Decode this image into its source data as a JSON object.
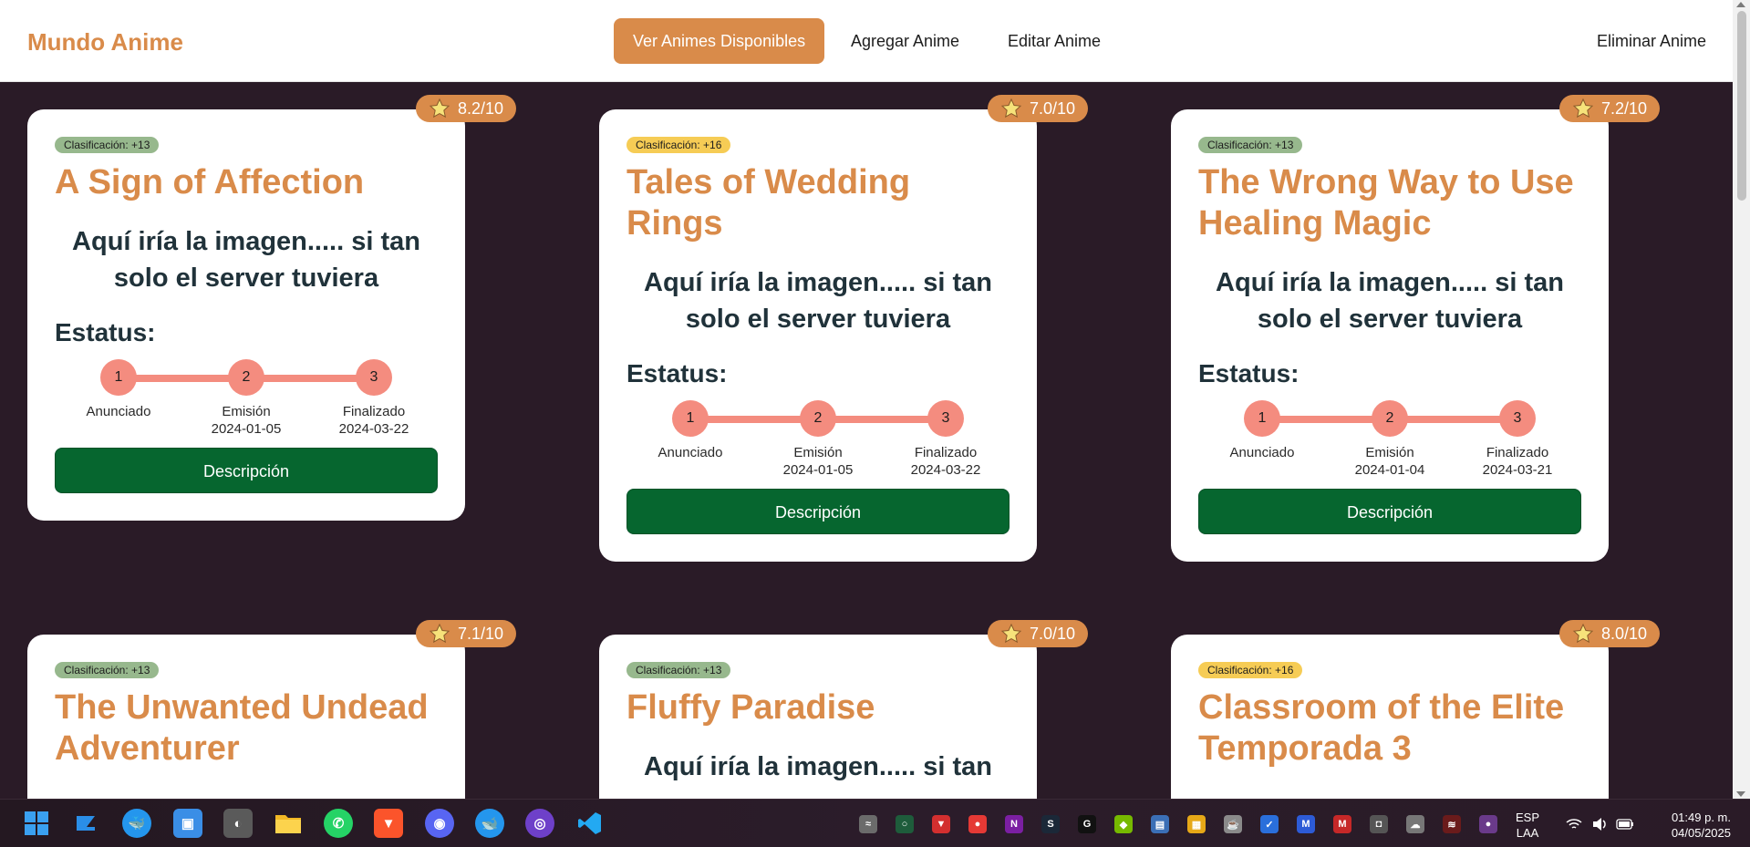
{
  "navbar": {
    "brand": "Mundo Anime",
    "links": [
      {
        "label": "Ver Animes Disponibles",
        "active": true
      },
      {
        "label": "Agregar Anime",
        "active": false
      },
      {
        "label": "Editar Anime",
        "active": false
      },
      {
        "label": "Eliminar Anime",
        "active": false
      }
    ]
  },
  "cards": [
    {
      "rating": "8.2/10",
      "classification": "Clasificación: +13",
      "classification_color": "green",
      "title": "A Sign of Affection",
      "image_placeholder": "Aquí iría la imagen..... si tan solo el server tuviera",
      "status_heading": "Estatus:",
      "steps": [
        {
          "number": "1",
          "label": "Anunciado",
          "date": ""
        },
        {
          "number": "2",
          "label": "Emisión",
          "date": "2024-01-05"
        },
        {
          "number": "3",
          "label": "Finalizado",
          "date": "2024-03-22"
        }
      ],
      "button": "Descripción"
    },
    {
      "rating": "7.0/10",
      "classification": "Clasificación: +16",
      "classification_color": "yellow",
      "title": "Tales of Wedding Rings",
      "image_placeholder": "Aquí iría la imagen..... si tan solo el server tuviera",
      "status_heading": "Estatus:",
      "steps": [
        {
          "number": "1",
          "label": "Anunciado",
          "date": ""
        },
        {
          "number": "2",
          "label": "Emisión",
          "date": "2024-01-05"
        },
        {
          "number": "3",
          "label": "Finalizado",
          "date": "2024-03-22"
        }
      ],
      "button": "Descripción"
    },
    {
      "rating": "7.2/10",
      "classification": "Clasificación: +13",
      "classification_color": "green",
      "title": "The Wrong Way to Use Healing Magic",
      "image_placeholder": "Aquí iría la imagen..... si tan solo el server tuviera",
      "status_heading": "Estatus:",
      "steps": [
        {
          "number": "1",
          "label": "Anunciado",
          "date": ""
        },
        {
          "number": "2",
          "label": "Emisión",
          "date": "2024-01-04"
        },
        {
          "number": "3",
          "label": "Finalizado",
          "date": "2024-03-21"
        }
      ],
      "button": "Descripción"
    },
    {
      "rating": "7.1/10",
      "classification": "Clasificación: +13",
      "classification_color": "green",
      "title": "The Unwanted Undead Adventurer"
    },
    {
      "rating": "7.0/10",
      "classification": "Clasificación: +13",
      "classification_color": "green",
      "title": "Fluffy Paradise",
      "image_placeholder": "Aquí iría la imagen..... si tan"
    },
    {
      "rating": "8.0/10",
      "classification": "Clasificación: +16",
      "classification_color": "yellow",
      "title": "Classroom of the Elite Temporada 3"
    }
  ],
  "taskbar": {
    "apps": [
      "windows-start",
      "dev-tool",
      "docker-desktop",
      "photo-app",
      "anime-avatar",
      "file-explorer",
      "whatsapp",
      "brave-browser",
      "discord",
      "docker",
      "github-desktop",
      "vscode"
    ],
    "language": "ESP",
    "layout": "LAA",
    "time": "01:49 p. m.",
    "date": "04/05/2025"
  },
  "colors": {
    "accent": "#d98b4a",
    "background": "#2a1b27",
    "button_green": "#06662f",
    "stepper": "#f48c7f",
    "badge_green": "#97b88d",
    "badge_yellow": "#f6cc55"
  }
}
